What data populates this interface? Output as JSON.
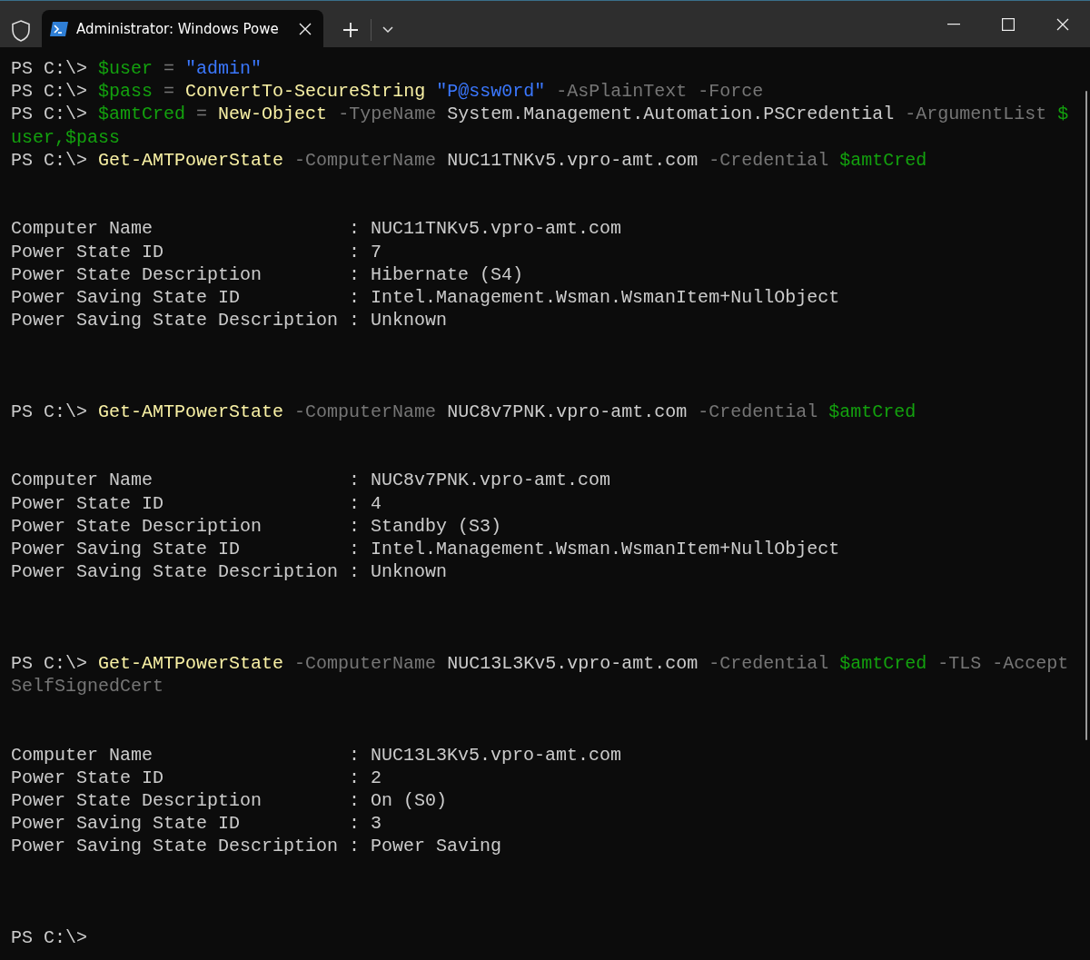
{
  "window": {
    "tabs": [
      {
        "title": "Administrator: Windows Powe",
        "selected": true
      }
    ]
  },
  "terminal": {
    "lines": [
      {
        "kind": "code",
        "segments": [
          {
            "kind": "prompt",
            "text": "PS C:\\>"
          },
          {
            "kind": "variable",
            "text": "$user"
          },
          {
            "kind": "operator",
            "text": "="
          },
          {
            "kind": "string",
            "text": "\"admin\""
          }
        ]
      },
      {
        "kind": "code",
        "segments": [
          {
            "kind": "prompt",
            "text": "PS C:\\>"
          },
          {
            "kind": "variable",
            "text": "$pass"
          },
          {
            "kind": "operator",
            "text": "="
          },
          {
            "kind": "command",
            "text": "ConvertTo-SecureString"
          },
          {
            "kind": "string",
            "text": "\"P@ssw0rd\""
          },
          {
            "kind": "parameter",
            "text": "-AsPlainText"
          },
          {
            "kind": "parameter",
            "text": "-Force"
          }
        ]
      },
      {
        "kind": "code",
        "segments": [
          {
            "kind": "prompt",
            "text": "PS C:\\>"
          },
          {
            "kind": "variable",
            "text": "$amtCred"
          },
          {
            "kind": "operator",
            "text": "="
          },
          {
            "kind": "command",
            "text": "New-Object"
          },
          {
            "kind": "parameter",
            "text": "-TypeName"
          },
          {
            "kind": "argument",
            "text": "System.Management.Automation.PSCredential"
          },
          {
            "kind": "parameter",
            "text": "-ArgumentList"
          },
          {
            "kind": "variable",
            "text": "$"
          }
        ]
      },
      {
        "kind": "code",
        "segments": [
          {
            "kind": "variable",
            "text": "user,$pass"
          }
        ]
      },
      {
        "kind": "code",
        "segments": [
          {
            "kind": "prompt",
            "text": "PS C:\\>"
          },
          {
            "kind": "command",
            "text": "Get-AMTPowerState"
          },
          {
            "kind": "parameter",
            "text": "-ComputerName"
          },
          {
            "kind": "argument",
            "text": "NUC11TNKv5.vpro-amt.com"
          },
          {
            "kind": "parameter",
            "text": "-Credential"
          },
          {
            "kind": "variable",
            "text": "$amtCred"
          }
        ]
      },
      {
        "kind": "blank"
      },
      {
        "kind": "blank"
      },
      {
        "kind": "code",
        "segments": [
          {
            "kind": "output",
            "text": "Computer Name                  : NUC11TNKv5.vpro-amt.com"
          }
        ]
      },
      {
        "kind": "code",
        "segments": [
          {
            "kind": "output",
            "text": "Power State ID                 : 7"
          }
        ]
      },
      {
        "kind": "code",
        "segments": [
          {
            "kind": "output",
            "text": "Power State Description        : Hibernate (S4)"
          }
        ]
      },
      {
        "kind": "code",
        "segments": [
          {
            "kind": "output",
            "text": "Power Saving State ID          : Intel.Management.Wsman.WsmanItem+NullObject"
          }
        ]
      },
      {
        "kind": "code",
        "segments": [
          {
            "kind": "output",
            "text": "Power Saving State Description : Unknown"
          }
        ]
      },
      {
        "kind": "blank"
      },
      {
        "kind": "blank"
      },
      {
        "kind": "blank"
      },
      {
        "kind": "code",
        "segments": [
          {
            "kind": "prompt",
            "text": "PS C:\\>"
          },
          {
            "kind": "command",
            "text": "Get-AMTPowerState"
          },
          {
            "kind": "parameter",
            "text": "-ComputerName"
          },
          {
            "kind": "argument",
            "text": "NUC8v7PNK.vpro-amt.com"
          },
          {
            "kind": "parameter",
            "text": "-Credential"
          },
          {
            "kind": "variable",
            "text": "$amtCred"
          }
        ]
      },
      {
        "kind": "blank"
      },
      {
        "kind": "blank"
      },
      {
        "kind": "code",
        "segments": [
          {
            "kind": "output",
            "text": "Computer Name                  : NUC8v7PNK.vpro-amt.com"
          }
        ]
      },
      {
        "kind": "code",
        "segments": [
          {
            "kind": "output",
            "text": "Power State ID                 : 4"
          }
        ]
      },
      {
        "kind": "code",
        "segments": [
          {
            "kind": "output",
            "text": "Power State Description        : Standby (S3)"
          }
        ]
      },
      {
        "kind": "code",
        "segments": [
          {
            "kind": "output",
            "text": "Power Saving State ID          : Intel.Management.Wsman.WsmanItem+NullObject"
          }
        ]
      },
      {
        "kind": "code",
        "segments": [
          {
            "kind": "output",
            "text": "Power Saving State Description : Unknown"
          }
        ]
      },
      {
        "kind": "blank"
      },
      {
        "kind": "blank"
      },
      {
        "kind": "blank"
      },
      {
        "kind": "code",
        "segments": [
          {
            "kind": "prompt",
            "text": "PS C:\\>"
          },
          {
            "kind": "command",
            "text": "Get-AMTPowerState"
          },
          {
            "kind": "parameter",
            "text": "-ComputerName"
          },
          {
            "kind": "argument",
            "text": "NUC13L3Kv5.vpro-amt.com"
          },
          {
            "kind": "parameter",
            "text": "-Credential"
          },
          {
            "kind": "variable",
            "text": "$amtCred"
          },
          {
            "kind": "parameter",
            "text": "-TLS"
          },
          {
            "kind": "parameter",
            "text": "-Accept"
          }
        ]
      },
      {
        "kind": "code",
        "segments": [
          {
            "kind": "parameter",
            "text": "SelfSignedCert"
          }
        ]
      },
      {
        "kind": "blank"
      },
      {
        "kind": "blank"
      },
      {
        "kind": "code",
        "segments": [
          {
            "kind": "output",
            "text": "Computer Name                  : NUC13L3Kv5.vpro-amt.com"
          }
        ]
      },
      {
        "kind": "code",
        "segments": [
          {
            "kind": "output",
            "text": "Power State ID                 : 2"
          }
        ]
      },
      {
        "kind": "code",
        "segments": [
          {
            "kind": "output",
            "text": "Power State Description        : On (S0)"
          }
        ]
      },
      {
        "kind": "code",
        "segments": [
          {
            "kind": "output",
            "text": "Power Saving State ID          : 3"
          }
        ]
      },
      {
        "kind": "code",
        "segments": [
          {
            "kind": "output",
            "text": "Power Saving State Description : Power Saving"
          }
        ]
      },
      {
        "kind": "blank"
      },
      {
        "kind": "blank"
      },
      {
        "kind": "blank"
      },
      {
        "kind": "code",
        "segments": [
          {
            "kind": "prompt",
            "text": "PS C:\\>"
          }
        ]
      }
    ]
  }
}
